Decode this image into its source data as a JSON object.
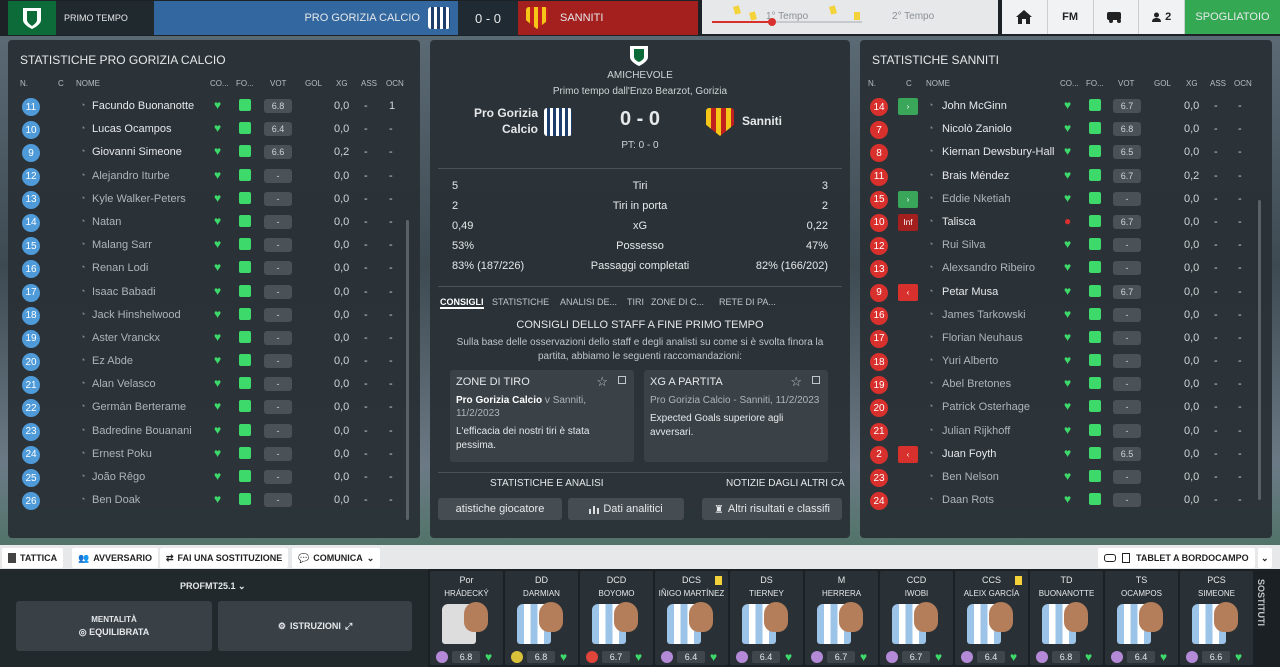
{
  "header": {
    "period": "PRIMO TEMPO",
    "home": "PRO GORIZIA CALCIO",
    "score": "0 - 0",
    "away": "SANNITI",
    "half1": "1° Tempo",
    "half2": "2° Tempo",
    "fm": "FM",
    "users": "2",
    "dressing_room": "SPOGLIATOIO"
  },
  "left": {
    "title": "STATISTICHE PRO GORIZIA CALCIO",
    "cols": {
      "n": "N.",
      "c": "C",
      "name": "NOME",
      "co": "CO...",
      "fo": "FO...",
      "vot": "VOT",
      "gol": "GOL",
      "xg": "XG",
      "ass": "ASS",
      "ocn": "OCN"
    },
    "rows": [
      {
        "n": "11",
        "name": "Facundo Buonanotte",
        "vot": "6.8",
        "xg": "0,0",
        "ass": "-",
        "ocn": "1"
      },
      {
        "n": "10",
        "name": "Lucas Ocampos",
        "vot": "6.4",
        "xg": "0,0",
        "ass": "-",
        "ocn": "-"
      },
      {
        "n": "9",
        "name": "Giovanni Simeone",
        "vot": "6.6",
        "xg": "0,2",
        "ass": "-",
        "ocn": "-"
      },
      {
        "n": "12",
        "name": "Alejandro Iturbe",
        "vot": "-",
        "xg": "0,0",
        "ass": "-",
        "ocn": "-"
      },
      {
        "n": "13",
        "name": "Kyle Walker-Peters",
        "vot": "-",
        "xg": "0,0",
        "ass": "-",
        "ocn": "-"
      },
      {
        "n": "14",
        "name": "Natan",
        "vot": "-",
        "xg": "0,0",
        "ass": "-",
        "ocn": "-"
      },
      {
        "n": "15",
        "name": "Malang Sarr",
        "vot": "-",
        "xg": "0,0",
        "ass": "-",
        "ocn": "-"
      },
      {
        "n": "16",
        "name": "Renan Lodi",
        "vot": "-",
        "xg": "0,0",
        "ass": "-",
        "ocn": "-"
      },
      {
        "n": "17",
        "name": "Isaac Babadi",
        "vot": "-",
        "xg": "0,0",
        "ass": "-",
        "ocn": "-"
      },
      {
        "n": "18",
        "name": "Jack Hinshelwood",
        "vot": "-",
        "xg": "0,0",
        "ass": "-",
        "ocn": "-"
      },
      {
        "n": "19",
        "name": "Aster Vranckx",
        "vot": "-",
        "xg": "0,0",
        "ass": "-",
        "ocn": "-"
      },
      {
        "n": "20",
        "name": "Ez Abde",
        "vot": "-",
        "xg": "0,0",
        "ass": "-",
        "ocn": "-"
      },
      {
        "n": "21",
        "name": "Alan Velasco",
        "vot": "-",
        "xg": "0,0",
        "ass": "-",
        "ocn": "-"
      },
      {
        "n": "22",
        "name": "Germán Berterame",
        "vot": "-",
        "xg": "0,0",
        "ass": "-",
        "ocn": "-"
      },
      {
        "n": "23",
        "name": "Badredine Bouanani",
        "vot": "-",
        "xg": "0,0",
        "ass": "-",
        "ocn": "-"
      },
      {
        "n": "24",
        "name": "Ernest Poku",
        "vot": "-",
        "xg": "0,0",
        "ass": "-",
        "ocn": "-"
      },
      {
        "n": "25",
        "name": "João Rêgo",
        "vot": "-",
        "xg": "0,0",
        "ass": "-",
        "ocn": "-"
      },
      {
        "n": "26",
        "name": "Ben Doak",
        "vot": "-",
        "xg": "0,0",
        "ass": "-",
        "ocn": "-"
      }
    ]
  },
  "right": {
    "title": "STATISTICHE SANNITI",
    "rows": [
      {
        "n": "14",
        "name": "John McGinn",
        "vot": "6.7",
        "xg": "0,0",
        "ind": "sub-in"
      },
      {
        "n": "7",
        "name": "Nicolò Zaniolo",
        "vot": "6.8",
        "xg": "0,0",
        "ind": ""
      },
      {
        "n": "8",
        "name": "Kiernan Dewsbury-Hall",
        "vot": "6.5",
        "xg": "0,0",
        "ind": ""
      },
      {
        "n": "11",
        "name": "Brais Méndez",
        "vot": "6.7",
        "xg": "0,2",
        "ind": ""
      },
      {
        "n": "15",
        "name": "Eddie Nketiah",
        "vot": "-",
        "xg": "0,0",
        "ind": "sub-in"
      },
      {
        "n": "10",
        "name": "Talisca",
        "vot": "6.7",
        "xg": "0,0",
        "ind": "inf"
      },
      {
        "n": "12",
        "name": "Rui Silva",
        "vot": "-",
        "xg": "0,0",
        "ind": ""
      },
      {
        "n": "13",
        "name": "Alexsandro Ribeiro",
        "vot": "-",
        "xg": "0,0",
        "ind": ""
      },
      {
        "n": "9",
        "name": "Petar Musa",
        "vot": "6.7",
        "xg": "0,0",
        "ind": "sub-out"
      },
      {
        "n": "16",
        "name": "James Tarkowski",
        "vot": "-",
        "xg": "0,0",
        "ind": ""
      },
      {
        "n": "17",
        "name": "Florian Neuhaus",
        "vot": "-",
        "xg": "0,0",
        "ind": ""
      },
      {
        "n": "18",
        "name": "Yuri Alberto",
        "vot": "-",
        "xg": "0,0",
        "ind": ""
      },
      {
        "n": "19",
        "name": "Abel Bretones",
        "vot": "-",
        "xg": "0,0",
        "ind": ""
      },
      {
        "n": "20",
        "name": "Patrick Osterhage",
        "vot": "-",
        "xg": "0,0",
        "ind": ""
      },
      {
        "n": "21",
        "name": "Julian Rijkhoff",
        "vot": "-",
        "xg": "0,0",
        "ind": ""
      },
      {
        "n": "2",
        "name": "Juan Foyth",
        "vot": "6.5",
        "xg": "0,0",
        "ind": "sub-out"
      },
      {
        "n": "23",
        "name": "Ben Nelson",
        "vot": "-",
        "xg": "0,0",
        "ind": ""
      },
      {
        "n": "24",
        "name": "Daan Rots",
        "vot": "-",
        "xg": "0,0",
        "ind": ""
      }
    ],
    "inf_label": "Inf"
  },
  "center": {
    "competition": "AMICHEVOLE",
    "venue": "Primo tempo dall'Enzo Bearzot, Gorizia",
    "home": "Pro Gorizia Calcio",
    "away": "Sanniti",
    "score": "0 - 0",
    "ht": "PT: 0 - 0",
    "stats": [
      {
        "h": "5",
        "label": "Tiri",
        "a": "3"
      },
      {
        "h": "2",
        "label": "Tiri in porta",
        "a": "2"
      },
      {
        "h": "0,49",
        "label": "xG",
        "a": "0,22"
      },
      {
        "h": "53%",
        "label": "Possesso",
        "a": "47%"
      },
      {
        "h": "83% (187/226)",
        "label": "Passaggi completati",
        "a": "82% (166/202)"
      }
    ],
    "tabs": [
      "CONSIGLI",
      "STATISTICHE",
      "ANALISI DE...",
      "TIRI",
      "ZONE DI C...",
      "RETE DI PA..."
    ],
    "advice_title": "CONSIGLI DELLO STAFF A FINE PRIMO TEMPO",
    "advice_text": "Sulla base delle osservazioni dello staff e degli analisti su come si è svolta finora la partita, abbiamo le seguenti raccomandazioni:",
    "card1": {
      "title": "ZONE DI TIRO",
      "sub_bold": "Pro Gorizia Calcio",
      "sub": " v Sanniti, 11/2/2023",
      "body": "L'efficacia dei nostri tiri è stata pessima."
    },
    "card2": {
      "title": "XG A PARTITA",
      "sub": "Pro Gorizia Calcio - Sanniti, 11/2/2023",
      "body": "Expected Goals superiore agli avversari."
    },
    "sec1": "STATISTICHE E ANALISI",
    "sec2": "NOTIZIE DAGLI ALTRI CA",
    "pill1": "atistiche giocatore",
    "pill2": "Dati analitici",
    "pill3": "Altri risultati e classifi"
  },
  "bottom": {
    "tabs": [
      "TATTICA",
      "AVVERSARIO",
      "FAI UNA SOSTITUZIONE",
      "COMUNICA"
    ],
    "tablet": "TABLET A BORDOCAMPO",
    "tactic": "PROFMT25.1",
    "mentality_label": "MENTALITÀ",
    "mentality": "EQUILIBRATA",
    "instructions": "ISTRUZIONI",
    "subs_label": "SOSTITUTI",
    "players": [
      {
        "pos": "Por",
        "name": "HRÁDECKÝ",
        "rating": "6.8",
        "yc": false
      },
      {
        "pos": "DD",
        "name": "DARMIAN",
        "rating": "6.8",
        "yc": false
      },
      {
        "pos": "DCD",
        "name": "BOYOMO",
        "rating": "6.7",
        "yc": false
      },
      {
        "pos": "DCS",
        "name": "IÑIGO MARTÍNEZ",
        "rating": "6.4",
        "yc": true
      },
      {
        "pos": "DS",
        "name": "TIERNEY",
        "rating": "6.4",
        "yc": false
      },
      {
        "pos": "M",
        "name": "HERRERA",
        "rating": "6.7",
        "yc": false
      },
      {
        "pos": "CCD",
        "name": "IWOBI",
        "rating": "6.7",
        "yc": false
      },
      {
        "pos": "CCS",
        "name": "ALEIX GARCÍA",
        "rating": "6.4",
        "yc": true
      },
      {
        "pos": "TD",
        "name": "BUONANOTTE",
        "rating": "6.8",
        "yc": false
      },
      {
        "pos": "TS",
        "name": "OCAMPOS",
        "rating": "6.4",
        "yc": false
      },
      {
        "pos": "PCS",
        "name": "SIMEONE",
        "rating": "6.6",
        "yc": false
      }
    ]
  }
}
